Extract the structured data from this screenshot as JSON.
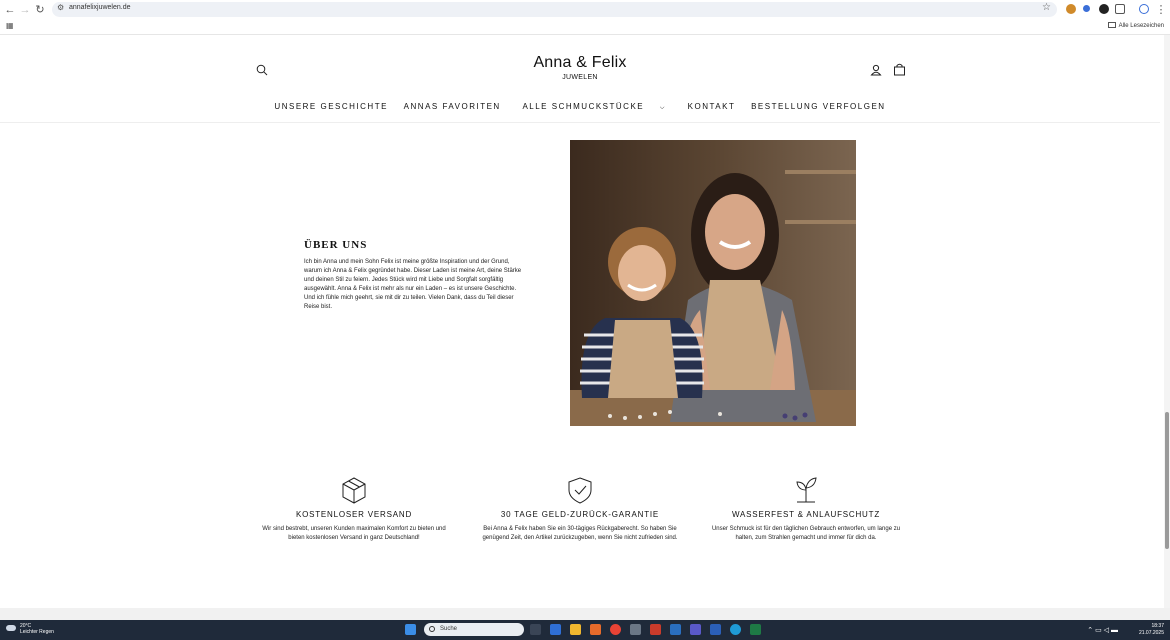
{
  "browser": {
    "url": "annafelixjuwelen.de",
    "bookmarks_all": "Alle Lesezeichen"
  },
  "header": {
    "brand": "Anna & Felix",
    "brand_sub": "JUWELEN",
    "nav": [
      "UNSERE GESCHICHTE",
      "ANNAS FAVORITEN",
      "ALLE SCHMUCKSTÜCKE",
      "KONTAKT",
      "BESTELLUNG VERFOLGEN"
    ]
  },
  "about": {
    "title": "ÜBER UNS",
    "text": "Ich bin Anna und mein Sohn Felix ist meine größte Inspiration und der Grund, warum ich Anna & Felix gegründet habe. Dieser Laden ist meine Art, deine Stärke und deinen Stil zu feiern. Jedes Stück wird mit Liebe und Sorgfalt sorgfältig ausgewählt. Anna & Felix ist mehr als nur ein Laden – es ist unsere Geschichte. Und ich fühle mich geehrt, sie mit dir zu teilen. Vielen Dank, dass du Teil dieser Reise bist."
  },
  "features": [
    {
      "icon": "box-icon",
      "title": "KOSTENLOSER VERSAND",
      "text": "Wir sind bestrebt, unseren Kunden maximalen Komfort zu bieten und bieten kostenlosen Versand in ganz Deutschland!"
    },
    {
      "icon": "shield-check-icon",
      "title": "30 TAGE GELD-ZURÜCK-GARANTIE",
      "text": "Bei Anna & Felix haben Sie ein 30-tägiges Rückgaberecht. So haben Sie genügend Zeit, den Artikel zurückzugeben, wenn Sie nicht zufrieden sind."
    },
    {
      "icon": "plant-icon",
      "title": "WASSERFEST & ANLAUFSCHUTZ",
      "text": "Unser Schmuck ist für den täglichen Gebrauch entworfen, um lange zu halten, zum Strahlen gemacht und immer für dich da."
    }
  ],
  "taskbar": {
    "temperature": "20°C",
    "weather": "Leichter Regen",
    "search": "Suche",
    "time": "18:37",
    "date": "21.07.2025"
  },
  "colors": {
    "text": "#1a1a1a",
    "taskbar": "#1f2a3a"
  }
}
